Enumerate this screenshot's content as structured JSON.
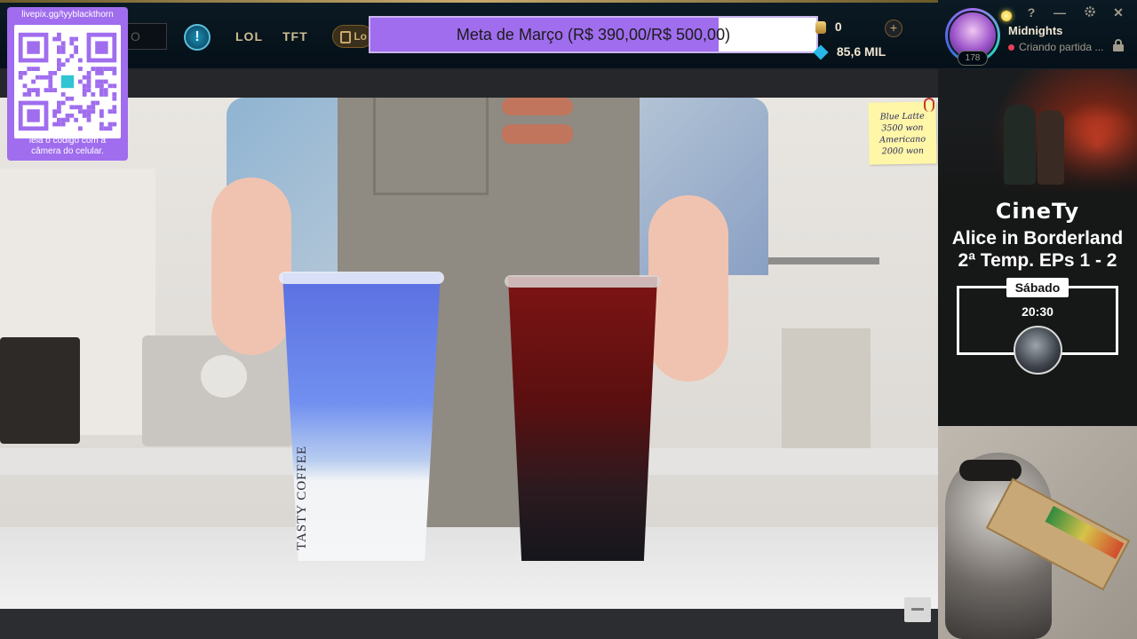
{
  "topbar": {
    "search_placeholder": "O",
    "info_label": "!",
    "nav": [
      "LOL",
      "TFT"
    ],
    "play_label": "Lo",
    "goal": {
      "text": "Meta de Março (R$ 390,00/R$ 500,00)",
      "current": 390,
      "target": 500,
      "fill_color": "#a06dee"
    },
    "rp_value": "0",
    "be_value": "85,6 MIL",
    "plus_label": "+"
  },
  "profile": {
    "name": "Midnights",
    "status": "Criando partida ...",
    "level": "178",
    "help_label": "?",
    "minimize_label": "—",
    "close_label": "✕"
  },
  "qr_widget": {
    "url": "livepix.gg/tyyblackthorn",
    "caption_line1": "leia o código com a",
    "caption_line2": "câmera do celular.",
    "bg_color": "#a06dee"
  },
  "scene": {
    "cup_brand": "TASTY COFFEE",
    "note_lines": [
      "Blue Latte",
      "3500 won",
      "Americano",
      "2000 won"
    ]
  },
  "sidebar": {
    "brand": "CineTy",
    "title_line1": "Alice in Borderland",
    "title_line2": "2ª Temp. EPs 1 - 2",
    "day": "Sábado",
    "time": "20:30"
  }
}
